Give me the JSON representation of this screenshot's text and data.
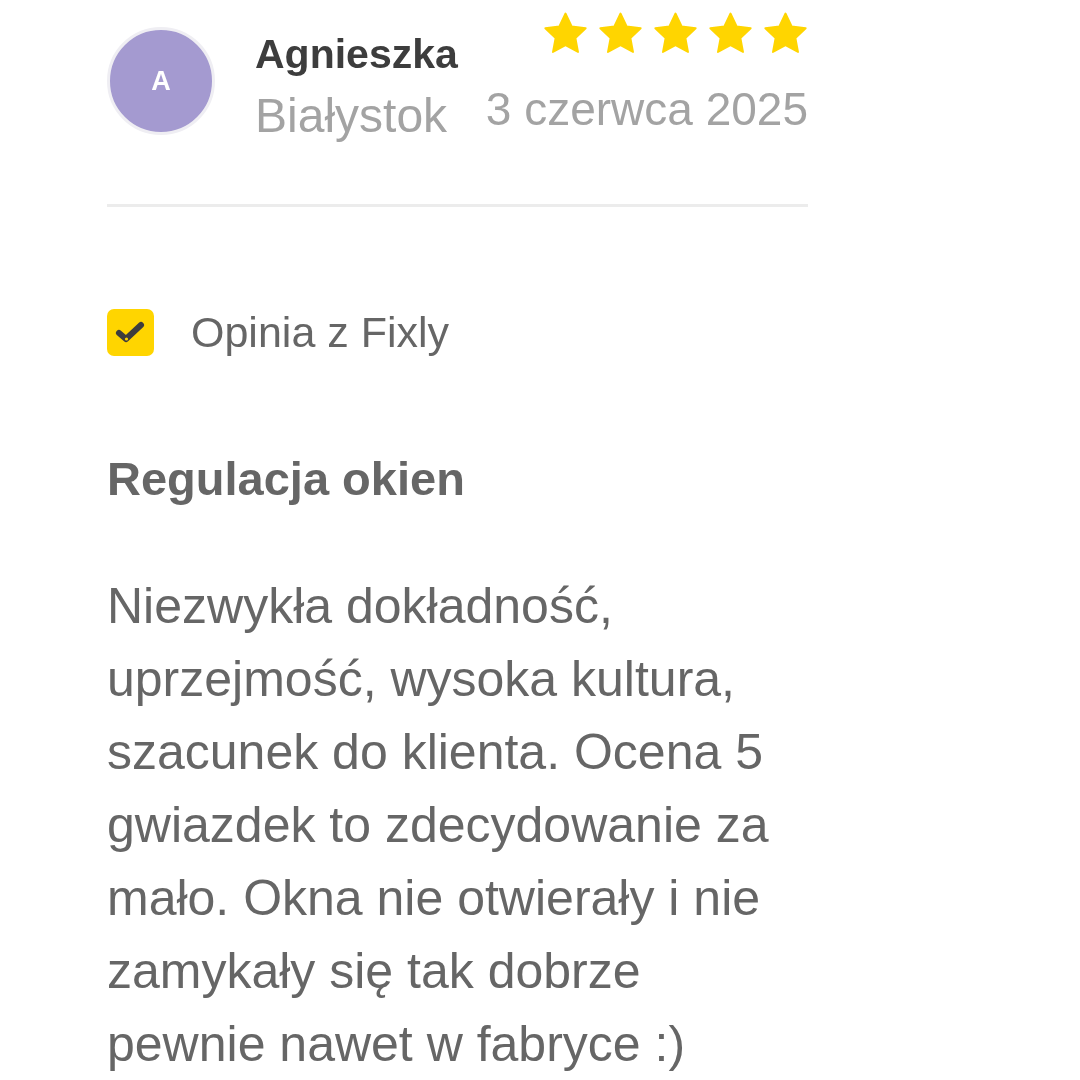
{
  "review": {
    "author": {
      "initial": "A",
      "name": "Agnieszka",
      "city": "Białystok"
    },
    "stars": 5,
    "date": "3 czerwca 2025",
    "source": "Opinia z Fixly",
    "title": "Regulacja okien",
    "body": "Niezwykła dokładność, uprzejmość, wysoka kultura, szacunek do klienta. Ocena 5 gwiazdek to zdecydowanie za mało. Okna nie otwierały i nie zamykały się tak dobrze pewnie nawet w fabryce :)"
  }
}
